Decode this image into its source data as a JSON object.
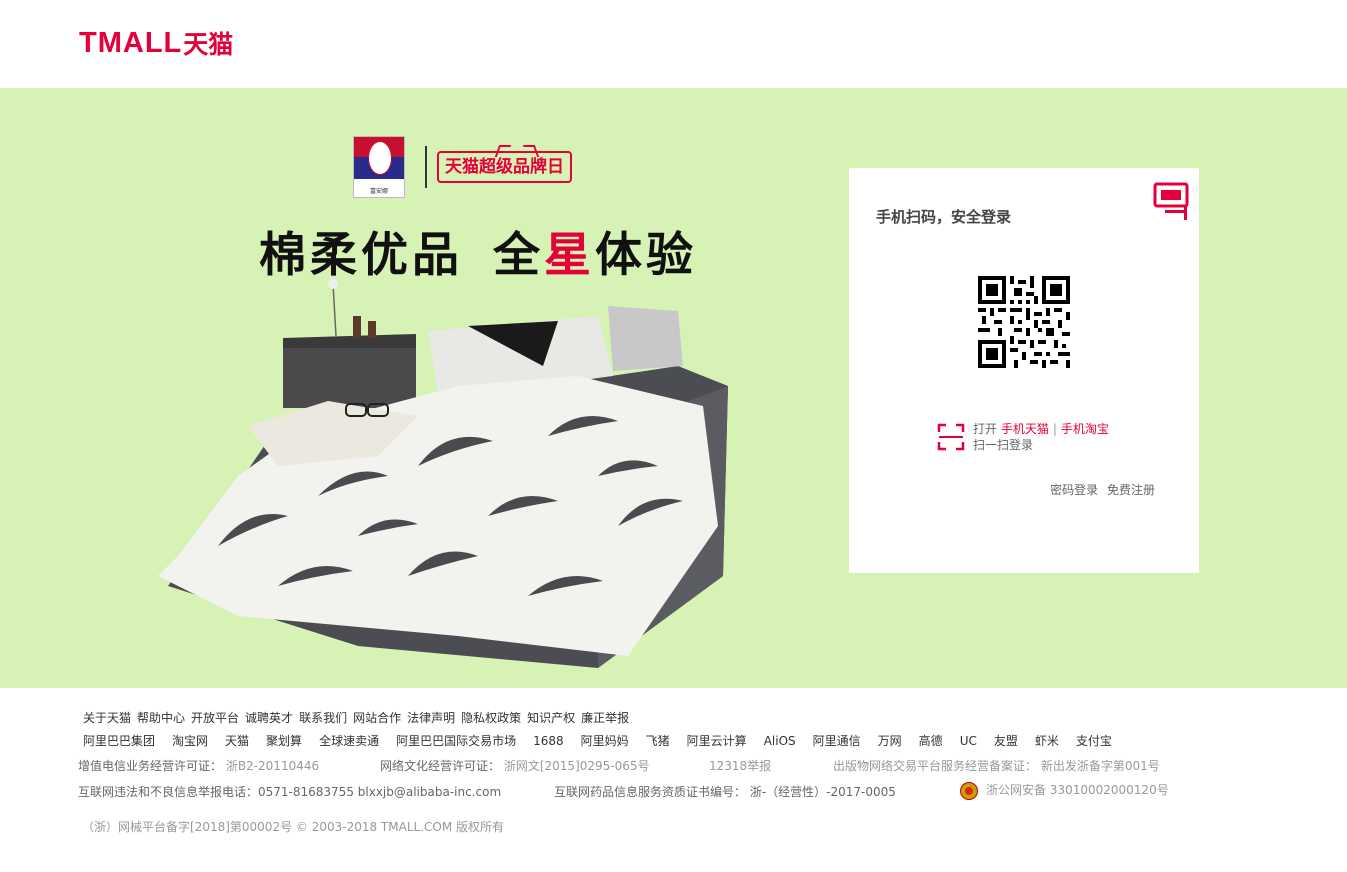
{
  "header": {
    "logo_en": "TMALL",
    "logo_zh": "天猫"
  },
  "banner": {
    "brand_logo_text": "富安娜",
    "badge": "天猫超级品牌日",
    "slogan_part1": "棉柔优品",
    "slogan_part2_a": "全",
    "slogan_part2_hl": "星",
    "slogan_part2_b": "体验"
  },
  "login": {
    "title": "手机扫码，安全登录",
    "open": "打开",
    "app1": "手机天猫",
    "separator": "|",
    "app2": "手机淘宝",
    "scan": "扫一扫登录",
    "password_login": "密码登录",
    "register": "免费注册"
  },
  "footer": {
    "row1": [
      "关于天猫",
      "帮助中心",
      "开放平台",
      "诚聘英才",
      "联系我们",
      "网站合作",
      "法律声明",
      "隐私权政策",
      "知识产权",
      "廉正举报"
    ],
    "row2": [
      "阿里巴巴集团",
      "淘宝网",
      "天猫",
      "聚划算",
      "全球速卖通",
      "阿里巴巴国际交易市场",
      "1688",
      "阿里妈妈",
      "飞猪",
      "阿里云计算",
      "AliOS",
      "阿里通信",
      "万网",
      "高德",
      "UC",
      "友盟",
      "虾米",
      "支付宝"
    ],
    "icp_label": "增值电信业务经营许可证：",
    "icp_value": "浙B2-20110446",
    "culture_label": "网络文化经营许可证：",
    "culture_value": "浙网文[2015]0295-065号",
    "report_12318": "12318举报",
    "publish_label": "出版物网络交易平台服务经营备案证：",
    "publish_value": "新出发浙备字第001号",
    "illegal_report": "互联网违法和不良信息举报电话：0571-81683755 blxxjb@alibaba-inc.com",
    "drug_info": "互联网药品信息服务资质证书编号： 浙-（经营性）-2017-0005",
    "police_record": "浙公网安备 33010002000120号",
    "copyright": "（浙）网械平台备字[2018]第00002号 © 2003-2018 TMALL.COM 版权所有"
  },
  "colors": {
    "brand_red": "#e4003a",
    "banner_bg": "#d7f2b5"
  }
}
